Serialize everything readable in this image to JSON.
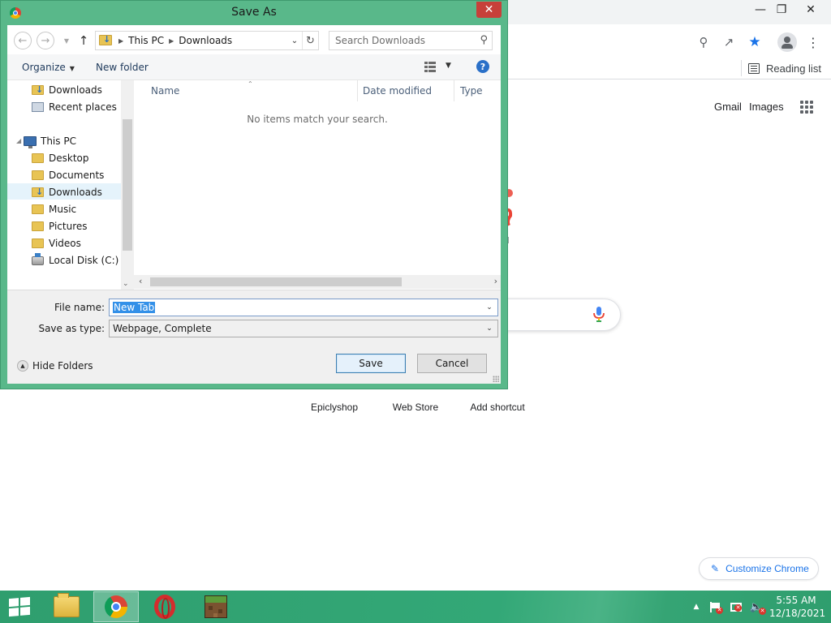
{
  "dialog": {
    "title": "Save As",
    "address_crumbs": [
      "This PC",
      "Downloads"
    ],
    "search_placeholder": "Search Downloads",
    "toolbar": {
      "organize": "Organize",
      "new_folder": "New folder"
    },
    "tree": [
      {
        "label": "Downloads",
        "icon": "downloads-folder-icon"
      },
      {
        "label": "Recent places",
        "icon": "recent-places-icon"
      },
      {
        "label": "This PC",
        "icon": "computer-icon"
      },
      {
        "label": "Desktop",
        "icon": "folder-icon"
      },
      {
        "label": "Documents",
        "icon": "folder-icon"
      },
      {
        "label": "Downloads",
        "icon": "downloads-folder-icon",
        "selected": true
      },
      {
        "label": "Music",
        "icon": "folder-icon"
      },
      {
        "label": "Pictures",
        "icon": "folder-icon"
      },
      {
        "label": "Videos",
        "icon": "folder-icon"
      },
      {
        "label": "Local Disk (C:)",
        "icon": "drive-icon"
      }
    ],
    "columns": [
      "Name",
      "Date modified",
      "Type"
    ],
    "empty_message": "No items match your search.",
    "file_name_label": "File name:",
    "file_name_value": "New Tab",
    "save_type_label": "Save as type:",
    "save_type_value": "Webpage, Complete",
    "hide_folders": "Hide Folders",
    "save_button": "Save",
    "cancel_button": "Cancel",
    "help_glyph": "?"
  },
  "browser": {
    "reading_list": "Reading list",
    "gmail": "Gmail",
    "images": "Images",
    "shortcuts": [
      "Epiclyshop",
      "Web Store",
      "Add shortcut"
    ],
    "customize": "Customize Chrome"
  },
  "taskbar": {
    "apps": [
      "file-explorer-icon",
      "chrome-icon",
      "opera-icon",
      "minecraft-icon"
    ],
    "time": "5:55 AM",
    "date": "12/18/2021"
  },
  "colors": {
    "dialog_frame": "#59b88a",
    "taskbar": "#33a877",
    "close_button": "#c7403a",
    "selection": "#3390e8",
    "accent": "#1a73e8"
  }
}
